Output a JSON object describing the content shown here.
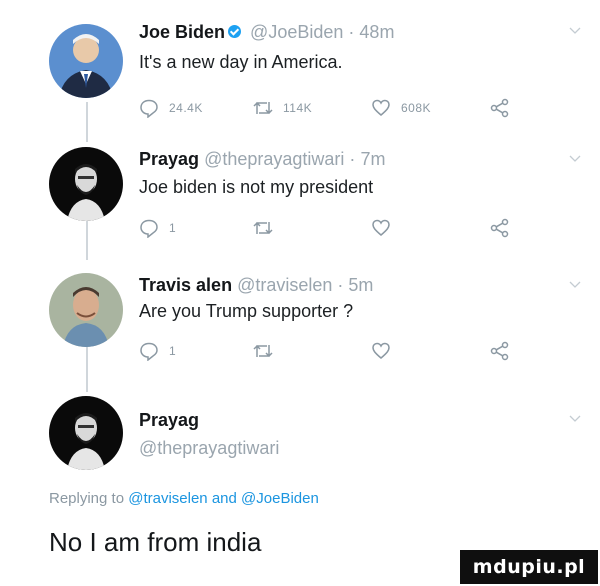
{
  "tweets": [
    {
      "name": "Joe Biden",
      "verified": true,
      "handle": "@JoeBiden",
      "separator": "·",
      "time": "48m",
      "text": "It's a new day in America.",
      "replies": "24.4K",
      "retweets": "114K",
      "likes": "608K"
    },
    {
      "name": "Prayag",
      "handle": "@theprayagtiwari",
      "separator": "·",
      "time": "7m",
      "text": "Joe biden is not my president",
      "replies": "1",
      "retweets": "",
      "likes": ""
    },
    {
      "name": "Travis alen",
      "handle": "@traviselen",
      "separator": "·",
      "time": "5m",
      "text": "Are you Trump supporter ?",
      "replies": "1",
      "retweets": "",
      "likes": ""
    }
  ],
  "reply": {
    "name": "Prayag",
    "handle": "@theprayagtiwari",
    "replying_prefix": "Replying to",
    "replying_user1": "@traviselen",
    "replying_and": "and",
    "replying_user2": "@JoeBiden",
    "text": "No I am from india"
  },
  "watermark": "mdupiu.pl",
  "colors": {
    "link": "#1b95e0",
    "verified": "#1da1f2",
    "muted": "#9aa5ae"
  },
  "icons": [
    "reply-icon",
    "retweet-icon",
    "like-icon",
    "share-icon",
    "chevron-down-icon",
    "verified-badge-icon"
  ]
}
